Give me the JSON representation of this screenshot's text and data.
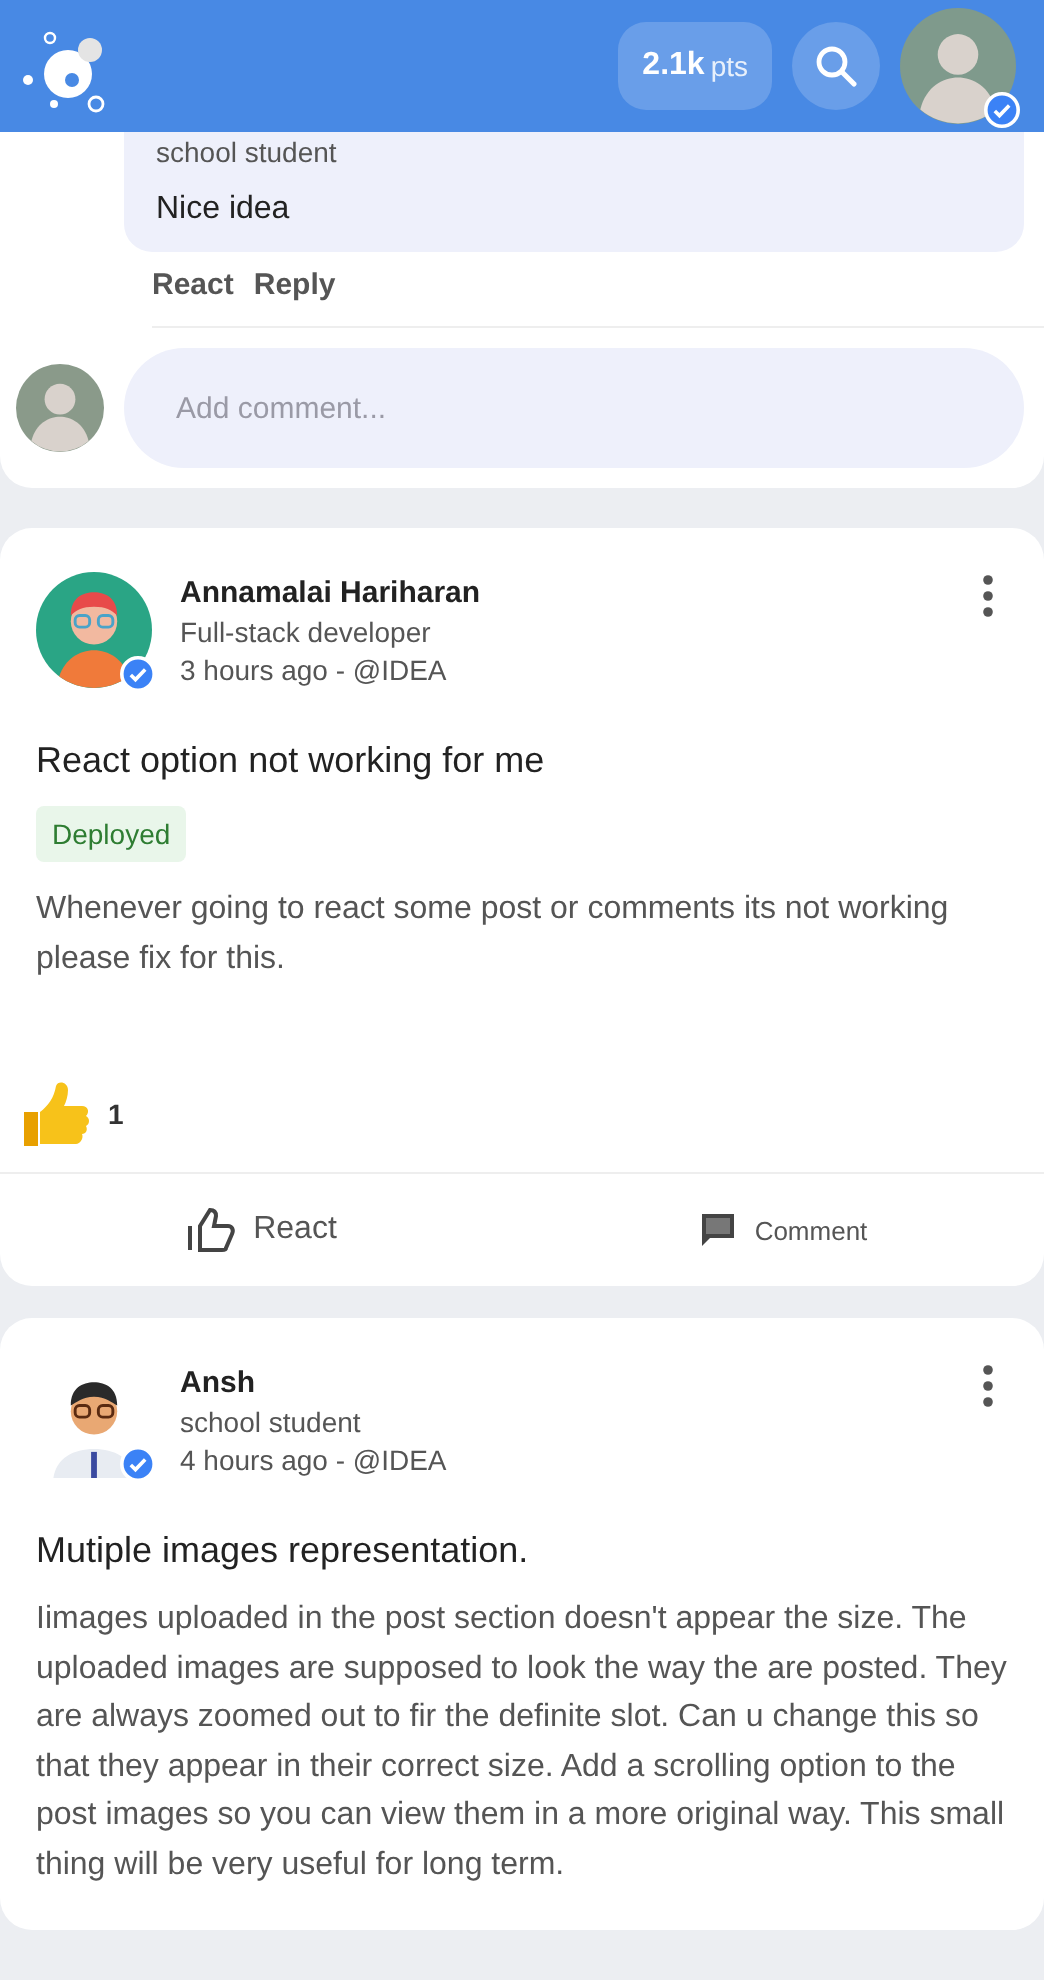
{
  "header": {
    "points_value": "2.1k",
    "points_unit": "pts",
    "profile_verified": true
  },
  "previous_comment": {
    "role": "school student",
    "text": "Nice idea",
    "actions": [
      "React",
      "Reply"
    ]
  },
  "comment_box": {
    "placeholder": "Add comment..."
  },
  "posts": [
    {
      "author": "Annamalai Hariharan",
      "avatar": {
        "kind": "developer"
      },
      "verified": true,
      "role": "Full-stack developer",
      "meta": "3 hours ago - @IDEA",
      "title": "React option not working for me",
      "status": "Deployed",
      "body": "Whenever going to react some post or comments its not working please fix for this.",
      "reactions": [
        {
          "kind": "like",
          "count": "1"
        }
      ],
      "actions": [
        {
          "kind": "react",
          "label": "React"
        },
        {
          "kind": "comment",
          "label": "Comment"
        }
      ]
    },
    {
      "author": "Ansh",
      "avatar": {
        "kind": "student"
      },
      "verified": true,
      "role": "school student",
      "meta": "4 hours ago - @IDEA",
      "title": "Mutiple images representation.",
      "body": "Iimages uploaded in the post section doesn't appear the size. The uploaded images are supposed to look the way the are posted. They are always zoomed out to fir the definite slot. Can u change this so that they appear in their correct size. Add a scrolling option to the post images so you can view them in a more original way. This small thing will be very useful for long term."
    }
  ]
}
